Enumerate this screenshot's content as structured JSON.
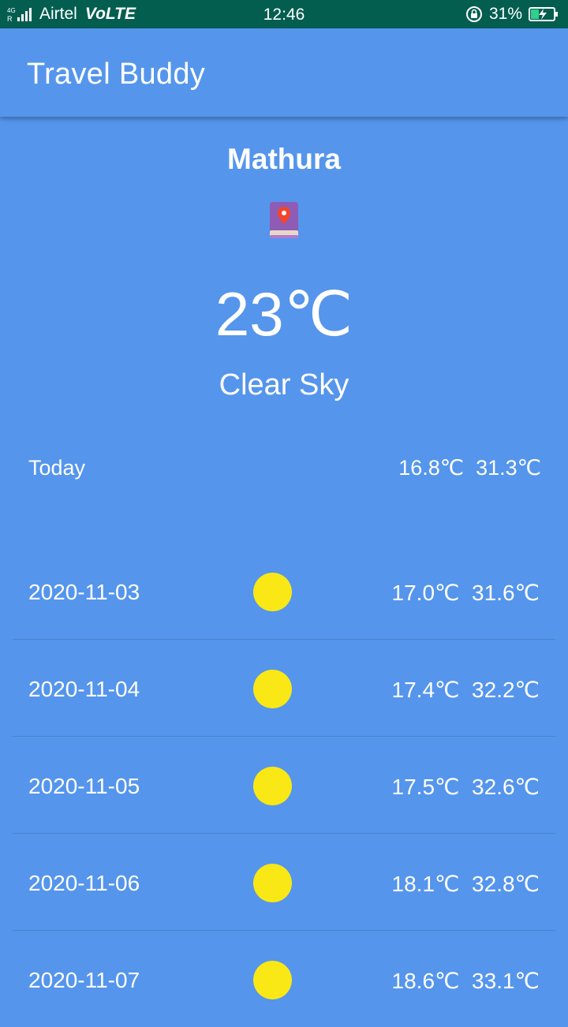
{
  "status_bar": {
    "network_type": "4G",
    "carrier": "Airtel",
    "volte": "VoLTE",
    "time": "12:46",
    "battery_percent": "31%",
    "battery_level": 0.31,
    "charging": true
  },
  "app_bar": {
    "title": "Travel Buddy"
  },
  "current": {
    "city": "Mathura",
    "icon": "map-pin-book-icon",
    "temperature": "23℃",
    "condition": "Clear Sky"
  },
  "today": {
    "label": "Today",
    "min": "16.8℃",
    "max": "31.3℃"
  },
  "forecast": [
    {
      "date": "2020-11-03",
      "icon": "sun-icon",
      "min": "17.0℃",
      "max": "31.6℃"
    },
    {
      "date": "2020-11-04",
      "icon": "sun-icon",
      "min": "17.4℃",
      "max": "32.2℃"
    },
    {
      "date": "2020-11-05",
      "icon": "sun-icon",
      "min": "17.5℃",
      "max": "32.6℃"
    },
    {
      "date": "2020-11-06",
      "icon": "sun-icon",
      "min": "18.1℃",
      "max": "32.8℃"
    },
    {
      "date": "2020-11-07",
      "icon": "sun-icon",
      "min": "18.6℃",
      "max": "33.1℃"
    }
  ],
  "colors": {
    "background": "#5595ec",
    "status_bar": "#035e50",
    "sun": "#f9e815",
    "divider": "#4a83cf"
  }
}
